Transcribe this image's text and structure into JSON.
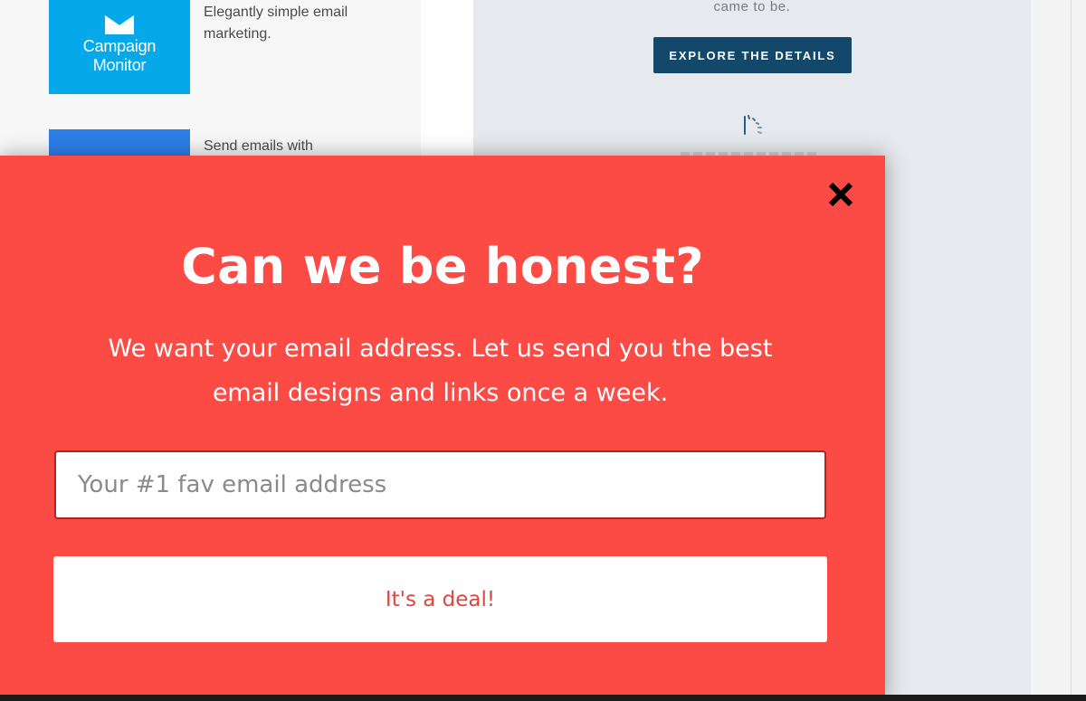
{
  "background": {
    "listing": [
      {
        "logo_lines": [
          "Campaign",
          "Monitor"
        ],
        "logo_color": "#05a8e8",
        "logo_icon": "envelope-icon",
        "description": "Elegantly simple email marketing."
      },
      {
        "logo_color": "#2e7ee8",
        "description": "Send emails with"
      }
    ],
    "right_panel": {
      "tagline": "came to be.",
      "explore_button_label": "EXPLORE THE DETAILS",
      "explore_button_color": "#14486a",
      "loading_icon": "spinner-icon"
    }
  },
  "popup": {
    "background_color": "#fc4a45",
    "close_icon": "close-icon",
    "title": "Can we be honest?",
    "body": "We want your email address. Let us send you the best email designs and links once a week.",
    "email_input": {
      "placeholder": "Your #1 fav email address",
      "value": ""
    },
    "submit_label": "It's a deal!"
  }
}
